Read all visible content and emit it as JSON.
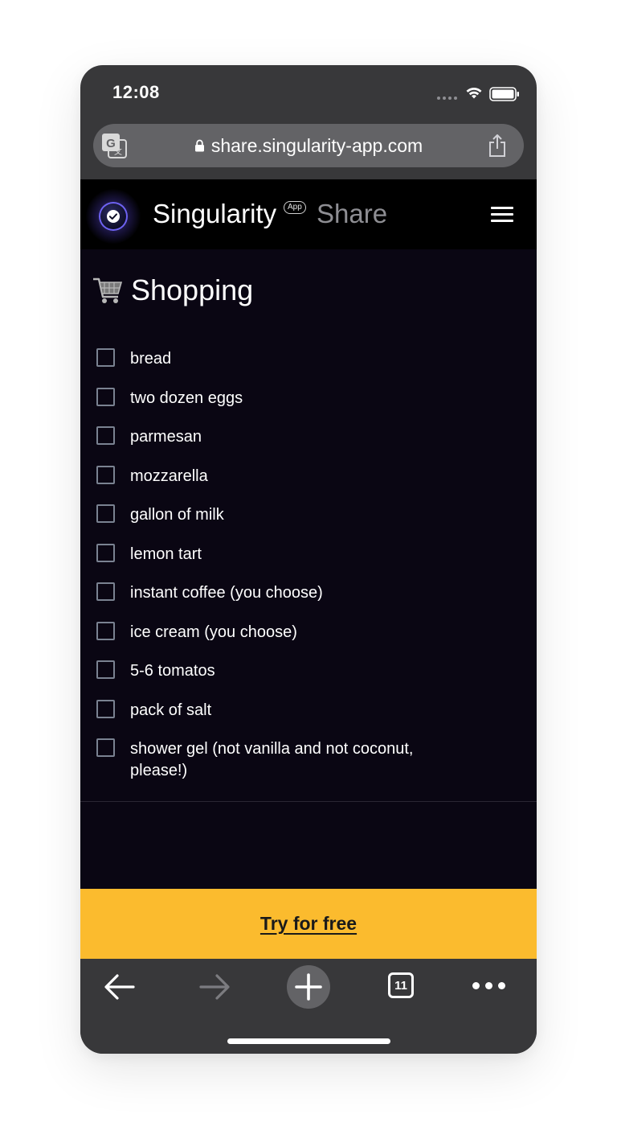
{
  "status_bar": {
    "time": "12:08"
  },
  "browser": {
    "url": "share.singularity-app.com",
    "tab_count": "11"
  },
  "app_header": {
    "brand": "Singularity",
    "badge": "App",
    "section": "Share"
  },
  "list": {
    "title": "Shopping",
    "items": [
      {
        "label": "bread",
        "checked": false
      },
      {
        "label": "two dozen eggs",
        "checked": false
      },
      {
        "label": "parmesan",
        "checked": false
      },
      {
        "label": "mozzarella",
        "checked": false
      },
      {
        "label": "gallon of milk",
        "checked": false
      },
      {
        "label": "lemon tart",
        "checked": false
      },
      {
        "label": "instant coffee (you choose)",
        "checked": false
      },
      {
        "label": "ice cream (you choose)",
        "checked": false
      },
      {
        "label": "5-6 tomatos",
        "checked": false
      },
      {
        "label": "pack of salt",
        "checked": false
      },
      {
        "label": "shower gel (not vanilla and not coconut, please!)",
        "checked": false
      }
    ]
  },
  "cta": {
    "label": "Try for free"
  },
  "colors": {
    "content_bg": "#0a0613",
    "header_bg": "#000000",
    "cta_bg": "#fbbb2e",
    "browser_chrome": "#38383a",
    "checkbox_border": "#7a8291"
  },
  "icons": {
    "translate": "translate-icon",
    "lock": "lock-icon",
    "share": "share-icon",
    "logo": "singularity-logo-icon",
    "menu": "hamburger-menu-icon",
    "cart": "shopping-cart-icon",
    "back": "back-arrow-icon",
    "forward": "forward-arrow-icon",
    "new_tab": "plus-icon",
    "tabs": "tabs-icon",
    "more": "more-icon"
  }
}
